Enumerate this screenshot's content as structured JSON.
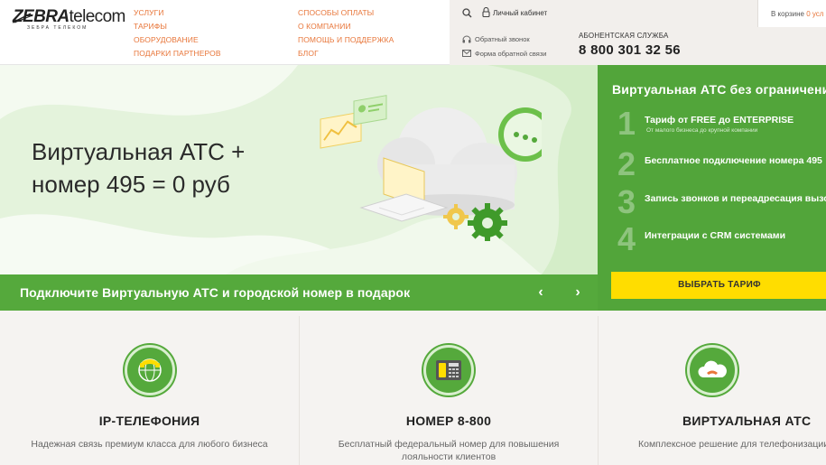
{
  "header": {
    "logo": {
      "brand_bold": "ZEBRA",
      "brand_light": "telecom",
      "tagline": "ЗЕБРА ТЕЛЕКОМ"
    },
    "nav_col1": [
      "УСЛУГИ",
      "ТАРИФЫ",
      "ОБОРУДОВАНИЕ",
      "ПОДАРКИ ПАРТНЕРОВ"
    ],
    "nav_col2": [
      "СПОСОБЫ ОПЛАТЫ",
      "О КОМПАНИИ",
      "ПОМОЩЬ И ПОДДЕРЖКА",
      "БЛОГ"
    ],
    "cabinet_label": "Личный кабинет",
    "cart_label": "В корзине",
    "cart_count": "0 усл",
    "callback_label": "Обратный звонок",
    "feedback_label": "Форма обратной связи",
    "support_label": "АБОНЕНТСКАЯ СЛУЖБА",
    "support_phone": "8 800 301 32 56"
  },
  "hero": {
    "title": "Виртуальная АТС +\nномер 495 = 0 руб",
    "promo_text": "Подключите Виртуальную АТС и городской номер в подарок",
    "prev_arrow": "‹",
    "next_arrow": "›"
  },
  "tariff": {
    "title": "Виртуальная АТС без ограничений",
    "features": [
      {
        "num": "1",
        "text": "Тариф от FREE до ENTERPRISE",
        "sub": "От малого бизнеса до крупной компании"
      },
      {
        "num": "2",
        "text": "Бесплатное подключение номера 495",
        "sub": ""
      },
      {
        "num": "3",
        "text": "Запись звонков и переадресация вызовов",
        "sub": ""
      },
      {
        "num": "4",
        "text": "Интеграции с CRM системами",
        "sub": ""
      }
    ],
    "button_label": "ВЫБРАТЬ ТАРИФ"
  },
  "cards": [
    {
      "title": "IP-ТЕЛЕФОНИЯ",
      "desc": "Надежная связь премиум класса для любого бизнеса"
    },
    {
      "title": "НОМЕР 8-800",
      "desc": "Бесплатный федеральный номер для повышения лояльности клиентов"
    },
    {
      "title": "ВИРТУАЛЬНАЯ АТС",
      "desc": "Комплексное решение для телефонизации"
    }
  ],
  "colors": {
    "brand_green": "#55a93c",
    "accent_orange": "#e8763a",
    "button_yellow": "#ffdd00"
  }
}
